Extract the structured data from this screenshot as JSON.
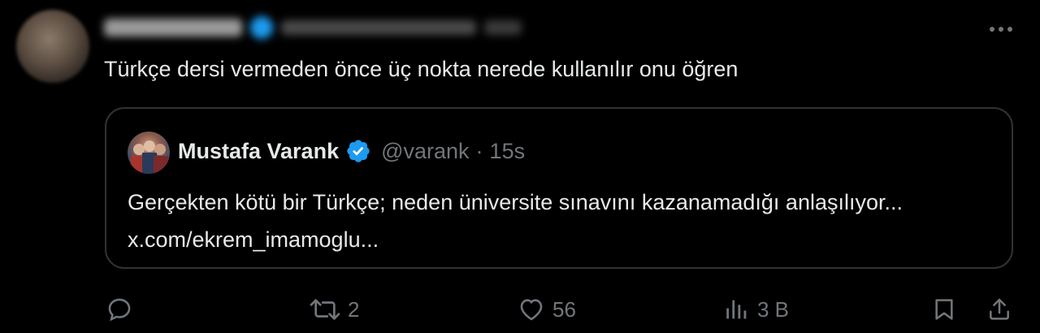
{
  "author": {
    "avatar_icon": "blurred-avatar",
    "name_blurred": true
  },
  "menu": {
    "more_icon": "more-horizontal-icon"
  },
  "tweet": {
    "text": "Türkçe dersi vermeden önce üç nokta nerede kullanılır onu öğren"
  },
  "quoted": {
    "name": "Mustafa Varank",
    "verified_icon": "verified-badge-icon",
    "handle": "@varank",
    "separator": "·",
    "time": "15s",
    "text": "Gerçekten kötü bir Türkçe; neden üniversite sınavını kazanamadığı anlaşılıyor... x.com/ekrem_imamoglu..."
  },
  "actions": {
    "reply_count": "",
    "retweet_count": "2",
    "like_count": "56",
    "views_count": "3 B"
  },
  "colors": {
    "background": "#000000",
    "text": "#e7e9ea",
    "muted": "#71767b",
    "border": "#2f3336",
    "verified": "#1d9bf0"
  }
}
